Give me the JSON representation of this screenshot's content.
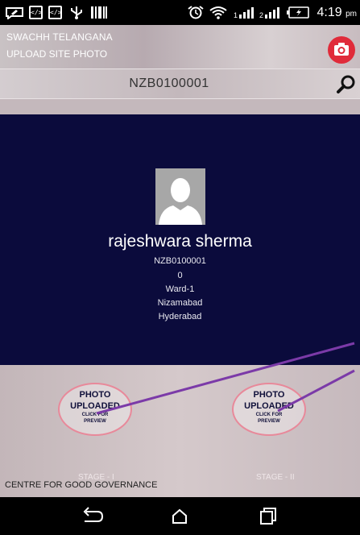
{
  "status_bar": {
    "time": "4:19",
    "ampm": "pm",
    "icons": [
      "message-icon",
      "code-icon",
      "code-icon",
      "usb-icon",
      "barcode-icon",
      "alarm-icon",
      "wifi-icon",
      "signal-icon",
      "signal-icon",
      "battery-icon"
    ]
  },
  "header": {
    "title": "SWACHH TELANGANA",
    "subtitle": "UPLOAD SITE PHOTO",
    "camera_icon": "camera-icon",
    "accent": "#e02b3a"
  },
  "search": {
    "value": "NZB0100001",
    "icon": "search-icon"
  },
  "profile": {
    "name": "rajeshwara sherma",
    "id": "NZB0100001",
    "count": "0",
    "ward": "Ward-1",
    "district": "Nizamabad",
    "city": "Hyderabad",
    "card_color": "#0b0b3c"
  },
  "stages": [
    {
      "line1": "PHOTO",
      "line2": "UPLOADED",
      "hint1": "CLICK FOR",
      "hint2": "PREVIEW",
      "label": "STAGE - I"
    },
    {
      "line1": "PHOTO",
      "line2": "UPLOADED",
      "hint1": "CLICK FOR",
      "hint2": "PREVIEW",
      "label": "STAGE - II"
    }
  ],
  "footer": {
    "text": "CENTRE FOR GOOD GOVERNANCE"
  },
  "nav": {
    "icons": [
      "back-icon",
      "home-icon",
      "recents-icon"
    ]
  },
  "annotation_color": "#7b3aa8"
}
